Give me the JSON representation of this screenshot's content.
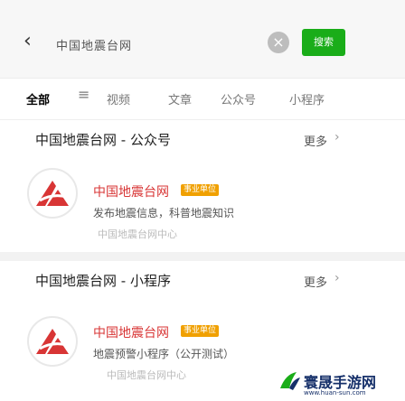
{
  "search": {
    "back_icon": "back-arrow-icon",
    "query": "中国地震台网",
    "clear_icon": "clear-icon",
    "button": "搜索"
  },
  "tabs": {
    "items": [
      {
        "label": "全部",
        "active": true
      },
      {
        "label": "视频"
      },
      {
        "label": "文章"
      },
      {
        "label": "公众号"
      },
      {
        "label": "小程序"
      }
    ],
    "filter_icon": "filter-icon"
  },
  "sections": [
    {
      "title": "中国地震台网 - 公众号",
      "more": "更多",
      "result": {
        "name": "中国地震台网",
        "badge": "事业单位",
        "desc": "发布地震信息，科普地震知识",
        "sub": "中国地震台网中心"
      }
    },
    {
      "title": "中国地震台网 - 小程序",
      "more": "更多",
      "result": {
        "name": "中国地震台网",
        "badge": "事业单位",
        "desc": "地震预警小程序（公开测试）",
        "sub": "中国地震台网中心"
      }
    }
  ],
  "colors": {
    "brand_green": "#1aad19",
    "name_red": "#d83535",
    "badge_orange": "#f0a000"
  },
  "watermark": {
    "text": "寰晟手游网",
    "url": "www.huan-sun.com"
  }
}
